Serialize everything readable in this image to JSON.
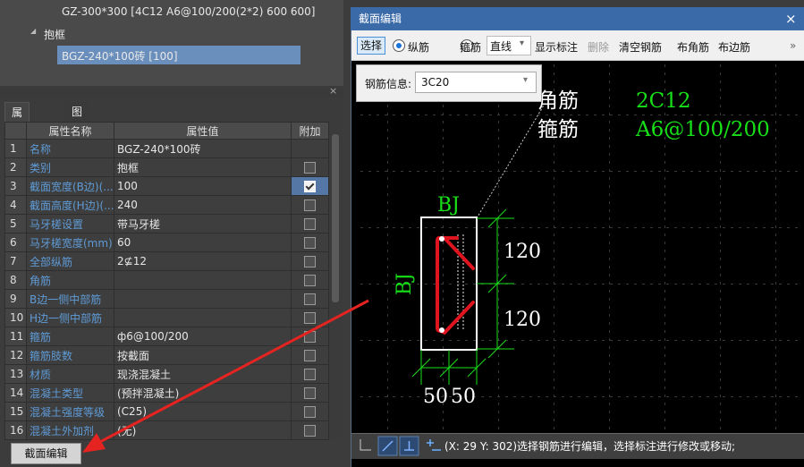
{
  "tree": {
    "items": [
      {
        "label": "GZ-300*300 [4C12 A6@100/200(2*2) 600 600]"
      },
      {
        "label": "抱框",
        "expander": "◢"
      },
      {
        "label": "BGZ-240*100砖 [100]"
      }
    ]
  },
  "panel": {
    "close_glyph": "×",
    "tabs": [
      "属性列表",
      "图层管理"
    ],
    "columns": [
      "",
      "属性名称",
      "属性值",
      "附加"
    ],
    "rows": [
      {
        "num": "1",
        "name": "名称",
        "value": "BGZ-240*100砖",
        "checked": null
      },
      {
        "num": "2",
        "name": "类别",
        "value": "抱框",
        "checked": false
      },
      {
        "num": "3",
        "name": "截面宽度(B边)(...",
        "value": "100",
        "checked": true
      },
      {
        "num": "4",
        "name": "截面高度(H边)(...",
        "value": "240",
        "checked": false
      },
      {
        "num": "5",
        "name": "马牙槎设置",
        "value": "带马牙槎",
        "checked": false
      },
      {
        "num": "6",
        "name": "马牙槎宽度(mm)",
        "value": "60",
        "checked": false
      },
      {
        "num": "7",
        "name": "全部纵筋",
        "value": "2⊈12",
        "checked": false
      },
      {
        "num": "8",
        "name": "角筋",
        "value": "",
        "checked": false
      },
      {
        "num": "9",
        "name": "B边一侧中部筋",
        "value": "",
        "checked": false
      },
      {
        "num": "10",
        "name": "H边一侧中部筋",
        "value": "",
        "checked": false
      },
      {
        "num": "11",
        "name": "箍筋",
        "value": "ф6@100/200",
        "checked": false
      },
      {
        "num": "12",
        "name": "箍筋肢数",
        "value": "按截面",
        "checked": false
      },
      {
        "num": "13",
        "name": "材质",
        "value": "现浇混凝土",
        "checked": false
      },
      {
        "num": "14",
        "name": "混凝土类型",
        "value": "(预拌混凝土)",
        "checked": false
      },
      {
        "num": "15",
        "name": "混凝土强度等级",
        "value": "(C25)",
        "checked": false
      },
      {
        "num": "16",
        "name": "混凝土外加剂",
        "value": "(无)",
        "checked": false
      }
    ],
    "section_edit_button": "截面编辑"
  },
  "dialog": {
    "title": "截面编辑",
    "close_glyph": "×",
    "toolbar": {
      "select": "选择",
      "longitudinal": "纵筋",
      "stirrup": "箍筋",
      "line_mode": "直线",
      "dd_arrow": "▾",
      "show_labels": "显示标注",
      "delete": "删除",
      "clear_rebar": "清空钢筋",
      "corner_rebar": "布角筋",
      "edge_rebar": "布边筋",
      "more": "»"
    },
    "rebar_info": {
      "label": "钢筋信息:",
      "value": "3C20",
      "arrow": "▾"
    },
    "canvas": {
      "corner_label": "角筋",
      "corner_value": "2C12",
      "stirrup_label": "箍筋",
      "stirrup_value": "A6@100/200",
      "bj_top": "BJ",
      "bj_side": "BJ",
      "dim_120a": "120",
      "dim_120b": "120",
      "dim_50a": "50",
      "dim_50b": "50"
    },
    "status": "(X: 29 Y: 302)选择钢筋进行编辑，选择标注进行修改或移动;"
  },
  "colors": {
    "green": "#18e018",
    "rebar_red": "#e0141e",
    "title_bar": "#3b6aa9",
    "arrow_red": "#e52421"
  }
}
